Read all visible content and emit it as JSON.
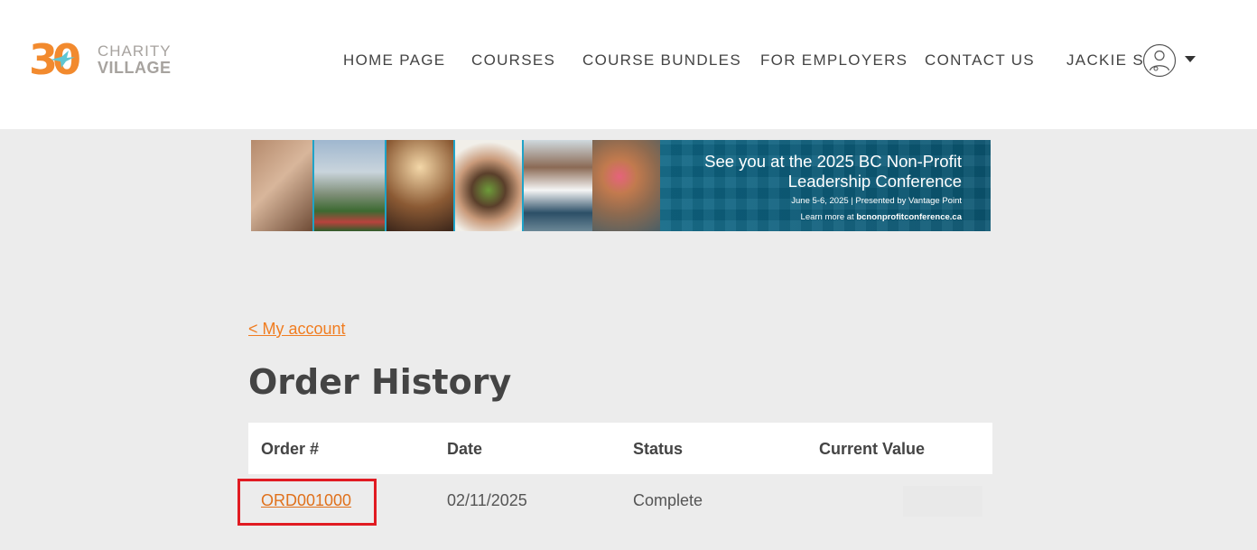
{
  "brand": {
    "logo_number": "30",
    "logo_line1": "CHARITY",
    "logo_line2": "VILLAGE",
    "accent_color": "#f07d21"
  },
  "nav": {
    "items": [
      {
        "label": "HOME PAGE"
      },
      {
        "label": "COURSES"
      },
      {
        "label": "COURSE BUNDLES"
      },
      {
        "label": "FOR EMPLOYERS"
      },
      {
        "label": "CONTACT US"
      }
    ],
    "user_name": "JACKIE S"
  },
  "banner": {
    "headline": "See you at the 2025 BC Non-Profit Leadership Conference",
    "sub1": "June 5-6, 2025 | Presented by Vantage Point",
    "sub2_prefix": "Learn more at ",
    "sub2_link": "bcnonprofitconference.ca"
  },
  "main": {
    "back_link": "< My account",
    "title": "Order History",
    "table": {
      "headers": [
        "Order #",
        "Date",
        "Status",
        "Current Value"
      ],
      "rows": [
        {
          "order": "ORD001000",
          "date": "02/11/2025",
          "status": "Complete",
          "value": ""
        }
      ]
    }
  },
  "colors": {
    "page_bg": "#ececec",
    "highlight_border": "#e11b22",
    "banner_bg": "#0e5f78"
  }
}
